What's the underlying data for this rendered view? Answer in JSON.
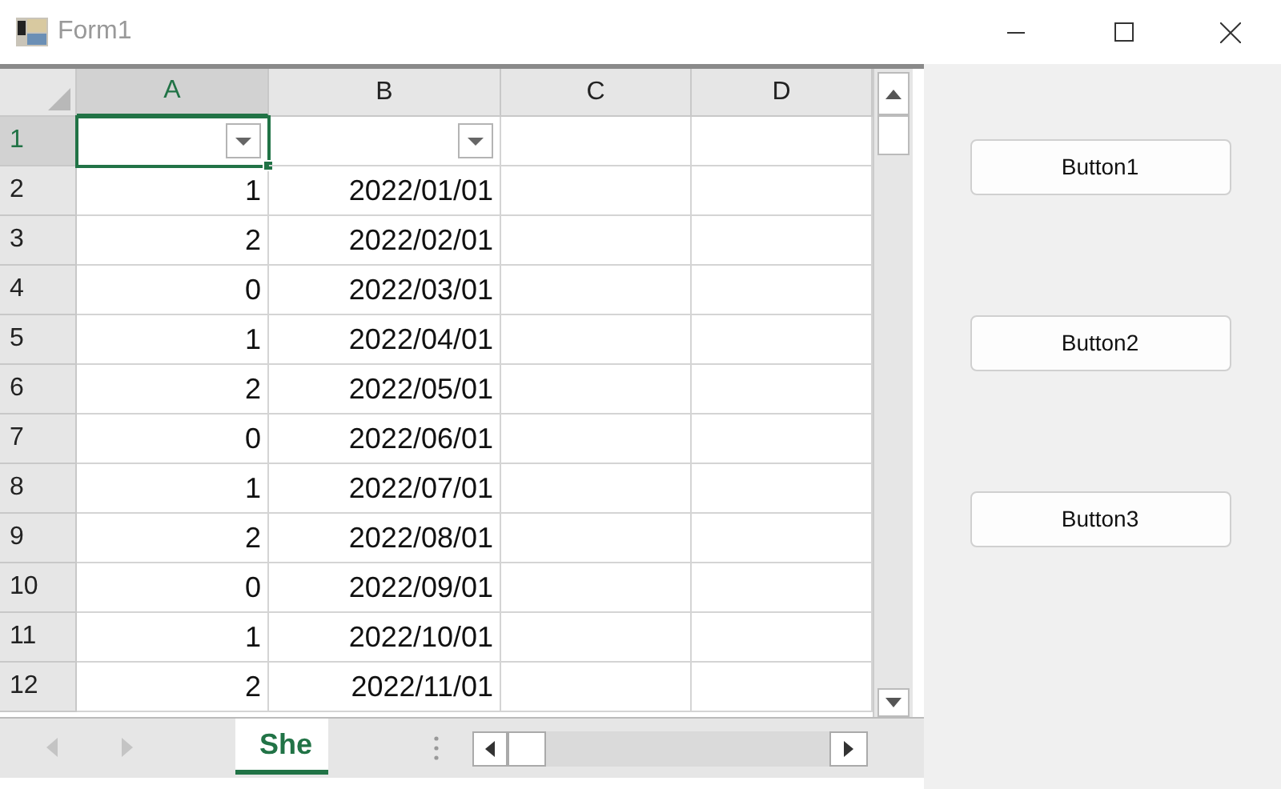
{
  "window": {
    "title": "Form1"
  },
  "sheet": {
    "columns": [
      {
        "label": "A",
        "selected": true
      },
      {
        "label": "B",
        "selected": false
      },
      {
        "label": "C",
        "selected": false
      },
      {
        "label": "D",
        "selected": false
      }
    ],
    "filter_row": {
      "label": "1",
      "selected": true,
      "filters": [
        {
          "selected": true
        },
        {
          "selected": false
        }
      ]
    },
    "rows": [
      {
        "label": "2",
        "cells": [
          "1",
          "2022/01/01"
        ]
      },
      {
        "label": "3",
        "cells": [
          "2",
          "2022/02/01"
        ]
      },
      {
        "label": "4",
        "cells": [
          "0",
          "2022/03/01"
        ]
      },
      {
        "label": "5",
        "cells": [
          "1",
          "2022/04/01"
        ]
      },
      {
        "label": "6",
        "cells": [
          "2",
          "2022/05/01"
        ]
      },
      {
        "label": "7",
        "cells": [
          "0",
          "2022/06/01"
        ]
      },
      {
        "label": "8",
        "cells": [
          "1",
          "2022/07/01"
        ]
      },
      {
        "label": "9",
        "cells": [
          "2",
          "2022/08/01"
        ]
      },
      {
        "label": "10",
        "cells": [
          "0",
          "2022/09/01"
        ]
      },
      {
        "label": "11",
        "cells": [
          "1",
          "2022/10/01"
        ]
      },
      {
        "label": "12",
        "cells": [
          "2",
          "2022/11/01"
        ]
      }
    ],
    "tabs": [
      {
        "label": "She",
        "selected": true
      }
    ]
  },
  "buttons": [
    "Button1",
    "Button2",
    "Button3"
  ]
}
